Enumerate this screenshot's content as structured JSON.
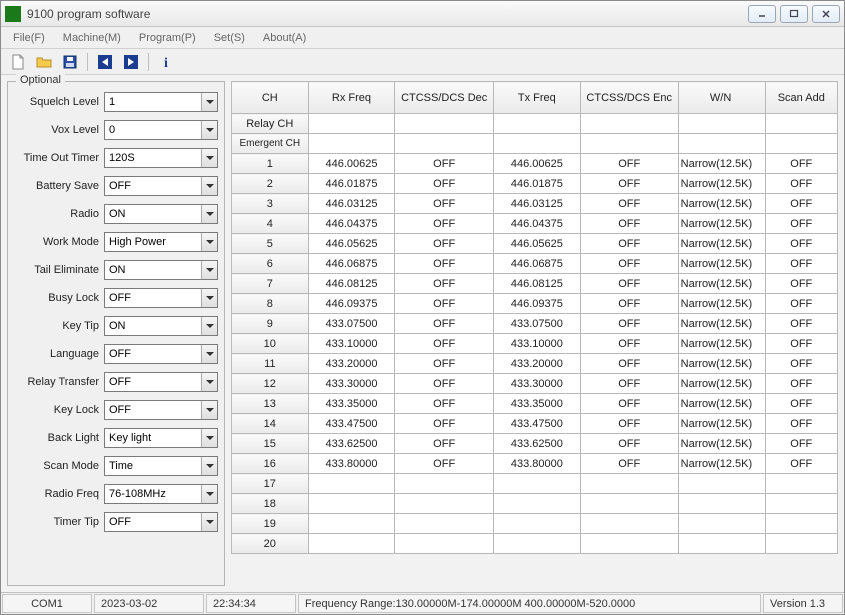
{
  "window": {
    "title": "9100 program software"
  },
  "menu": {
    "file": "File(F)",
    "machine": "Machine(M)",
    "program": "Program(P)",
    "set": "Set(S)",
    "about": "About(A)"
  },
  "optional": {
    "legend": "Optional",
    "fields": {
      "squelch_level": {
        "label": "Squelch Level",
        "value": "1"
      },
      "vox_level": {
        "label": "Vox Level",
        "value": "0"
      },
      "time_out_timer": {
        "label": "Time Out Timer",
        "value": "120S"
      },
      "battery_save": {
        "label": "Battery Save",
        "value": "OFF"
      },
      "radio": {
        "label": "Radio",
        "value": "ON"
      },
      "work_mode": {
        "label": "Work Mode",
        "value": "High Power"
      },
      "tail_eliminate": {
        "label": "Tail Eliminate",
        "value": "ON"
      },
      "busy_lock": {
        "label": "Busy Lock",
        "value": "OFF"
      },
      "key_tip": {
        "label": "Key Tip",
        "value": "ON"
      },
      "language": {
        "label": "Language",
        "value": "OFF"
      },
      "relay_transfer": {
        "label": "Relay Transfer",
        "value": "OFF"
      },
      "key_lock": {
        "label": "Key Lock",
        "value": "OFF"
      },
      "back_light": {
        "label": "Back Light",
        "value": "Key light"
      },
      "scan_mode": {
        "label": "Scan Mode",
        "value": "Time"
      },
      "radio_freq": {
        "label": "Radio Freq",
        "value": "76-108MHz"
      },
      "timer_tip": {
        "label": "Timer Tip",
        "value": "OFF"
      }
    }
  },
  "table": {
    "headers": {
      "ch": "CH",
      "rx": "Rx Freq",
      "ctcss_dec": "CTCSS/DCS Dec",
      "tx": "Tx Freq",
      "ctcss_enc": "CTCSS/DCS Enc",
      "wn": "W/N",
      "scan": "Scan Add"
    },
    "special_rows": {
      "relay": "Relay CH",
      "emergent": "Emergent CH"
    },
    "rows": [
      {
        "ch": "1",
        "rx": "446.00625",
        "dec": "OFF",
        "tx": "446.00625",
        "enc": "OFF",
        "wn": "Narrow(12.5K)",
        "scan": "OFF"
      },
      {
        "ch": "2",
        "rx": "446.01875",
        "dec": "OFF",
        "tx": "446.01875",
        "enc": "OFF",
        "wn": "Narrow(12.5K)",
        "scan": "OFF"
      },
      {
        "ch": "3",
        "rx": "446.03125",
        "dec": "OFF",
        "tx": "446.03125",
        "enc": "OFF",
        "wn": "Narrow(12.5K)",
        "scan": "OFF"
      },
      {
        "ch": "4",
        "rx": "446.04375",
        "dec": "OFF",
        "tx": "446.04375",
        "enc": "OFF",
        "wn": "Narrow(12.5K)",
        "scan": "OFF"
      },
      {
        "ch": "5",
        "rx": "446.05625",
        "dec": "OFF",
        "tx": "446.05625",
        "enc": "OFF",
        "wn": "Narrow(12.5K)",
        "scan": "OFF"
      },
      {
        "ch": "6",
        "rx": "446.06875",
        "dec": "OFF",
        "tx": "446.06875",
        "enc": "OFF",
        "wn": "Narrow(12.5K)",
        "scan": "OFF"
      },
      {
        "ch": "7",
        "rx": "446.08125",
        "dec": "OFF",
        "tx": "446.08125",
        "enc": "OFF",
        "wn": "Narrow(12.5K)",
        "scan": "OFF"
      },
      {
        "ch": "8",
        "rx": "446.09375",
        "dec": "OFF",
        "tx": "446.09375",
        "enc": "OFF",
        "wn": "Narrow(12.5K)",
        "scan": "OFF"
      },
      {
        "ch": "9",
        "rx": "433.07500",
        "dec": "OFF",
        "tx": "433.07500",
        "enc": "OFF",
        "wn": "Narrow(12.5K)",
        "scan": "OFF"
      },
      {
        "ch": "10",
        "rx": "433.10000",
        "dec": "OFF",
        "tx": "433.10000",
        "enc": "OFF",
        "wn": "Narrow(12.5K)",
        "scan": "OFF"
      },
      {
        "ch": "11",
        "rx": "433.20000",
        "dec": "OFF",
        "tx": "433.20000",
        "enc": "OFF",
        "wn": "Narrow(12.5K)",
        "scan": "OFF"
      },
      {
        "ch": "12",
        "rx": "433.30000",
        "dec": "OFF",
        "tx": "433.30000",
        "enc": "OFF",
        "wn": "Narrow(12.5K)",
        "scan": "OFF"
      },
      {
        "ch": "13",
        "rx": "433.35000",
        "dec": "OFF",
        "tx": "433.35000",
        "enc": "OFF",
        "wn": "Narrow(12.5K)",
        "scan": "OFF"
      },
      {
        "ch": "14",
        "rx": "433.47500",
        "dec": "OFF",
        "tx": "433.47500",
        "enc": "OFF",
        "wn": "Narrow(12.5K)",
        "scan": "OFF"
      },
      {
        "ch": "15",
        "rx": "433.62500",
        "dec": "OFF",
        "tx": "433.62500",
        "enc": "OFF",
        "wn": "Narrow(12.5K)",
        "scan": "OFF"
      },
      {
        "ch": "16",
        "rx": "433.80000",
        "dec": "OFF",
        "tx": "433.80000",
        "enc": "OFF",
        "wn": "Narrow(12.5K)",
        "scan": "OFF"
      },
      {
        "ch": "17",
        "rx": "",
        "dec": "",
        "tx": "",
        "enc": "",
        "wn": "",
        "scan": ""
      },
      {
        "ch": "18",
        "rx": "",
        "dec": "",
        "tx": "",
        "enc": "",
        "wn": "",
        "scan": ""
      },
      {
        "ch": "19",
        "rx": "",
        "dec": "",
        "tx": "",
        "enc": "",
        "wn": "",
        "scan": ""
      },
      {
        "ch": "20",
        "rx": "",
        "dec": "",
        "tx": "",
        "enc": "",
        "wn": "",
        "scan": ""
      }
    ]
  },
  "status": {
    "port": "COM1",
    "date": "2023-03-02",
    "time": "22:34:34",
    "range": "Frequency Range:130.00000M-174.00000M    400.00000M-520.0000",
    "version": "Version 1.3"
  }
}
